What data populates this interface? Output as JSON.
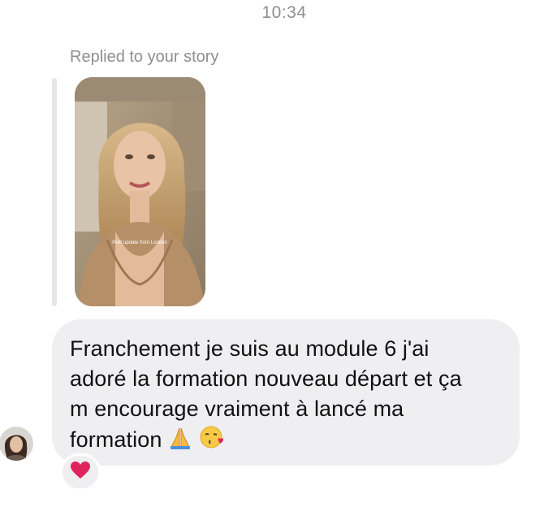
{
  "header": {
    "time": "10:34"
  },
  "story_reply": {
    "label": "Replied to your story",
    "story_overlay_text": "Petit update from London"
  },
  "message": {
    "text": "Franchement je suis au module 6 j'ai\nadoré la formation nouveau départ et ça\nm encourage vraiment à lancé ma\nformation ",
    "emojis": [
      "folded-hands",
      "face-blowing-kiss"
    ]
  },
  "reaction": {
    "emoji": "red-heart"
  },
  "colors": {
    "bubble": "#efeff1",
    "muted_text": "#8e8e93",
    "heart": "#e0245e"
  }
}
